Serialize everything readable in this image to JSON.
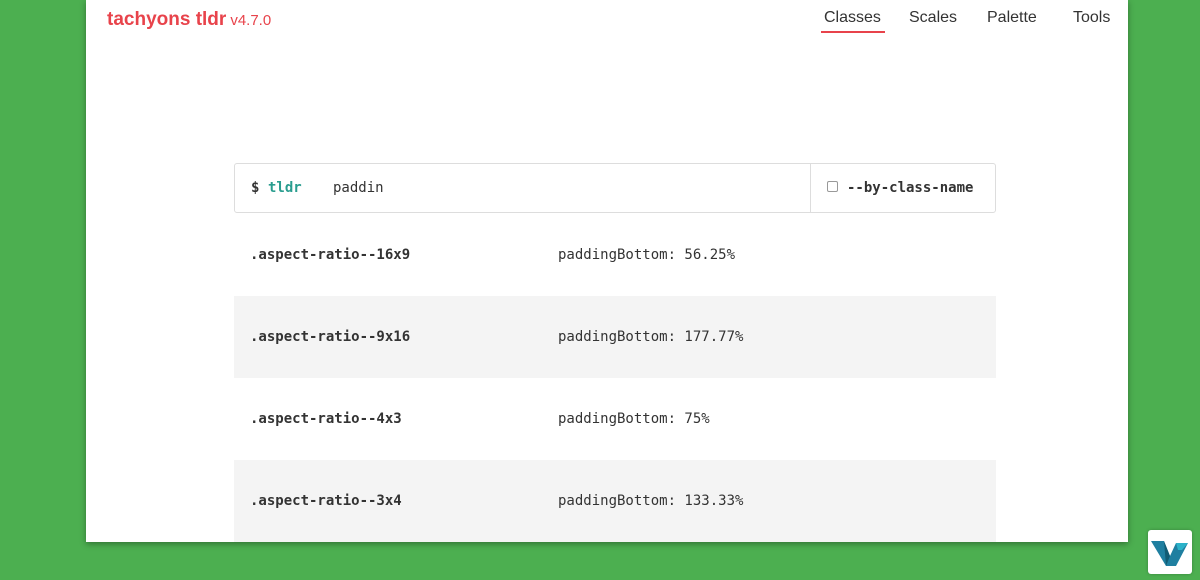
{
  "header": {
    "brand": "tachyons tldr",
    "version": "v4.7.0",
    "nav": [
      {
        "label": "Classes",
        "active": true
      },
      {
        "label": "Scales",
        "active": false
      },
      {
        "label": "Palette",
        "active": false
      },
      {
        "label": "Tools",
        "active": false
      }
    ]
  },
  "search": {
    "prompt": "$",
    "command": "tldr",
    "query": "paddin",
    "option_label": "--by-class-name",
    "option_checked": false
  },
  "results": [
    {
      "class": ".aspect-ratio--16x9",
      "declaration": "paddingBottom: 56.25%"
    },
    {
      "class": ".aspect-ratio--9x16",
      "declaration": "paddingBottom: 177.77%"
    },
    {
      "class": ".aspect-ratio--4x3",
      "declaration": "paddingBottom: 75%"
    },
    {
      "class": ".aspect-ratio--3x4",
      "declaration": "paddingBottom: 133.33%"
    }
  ],
  "colors": {
    "background": "#4CAF50",
    "brand": "#E8434B",
    "command": "#2A9D8F",
    "row_alt": "#f4f4f4"
  },
  "icons": {
    "corner_badge": "vk-logo-icon"
  }
}
